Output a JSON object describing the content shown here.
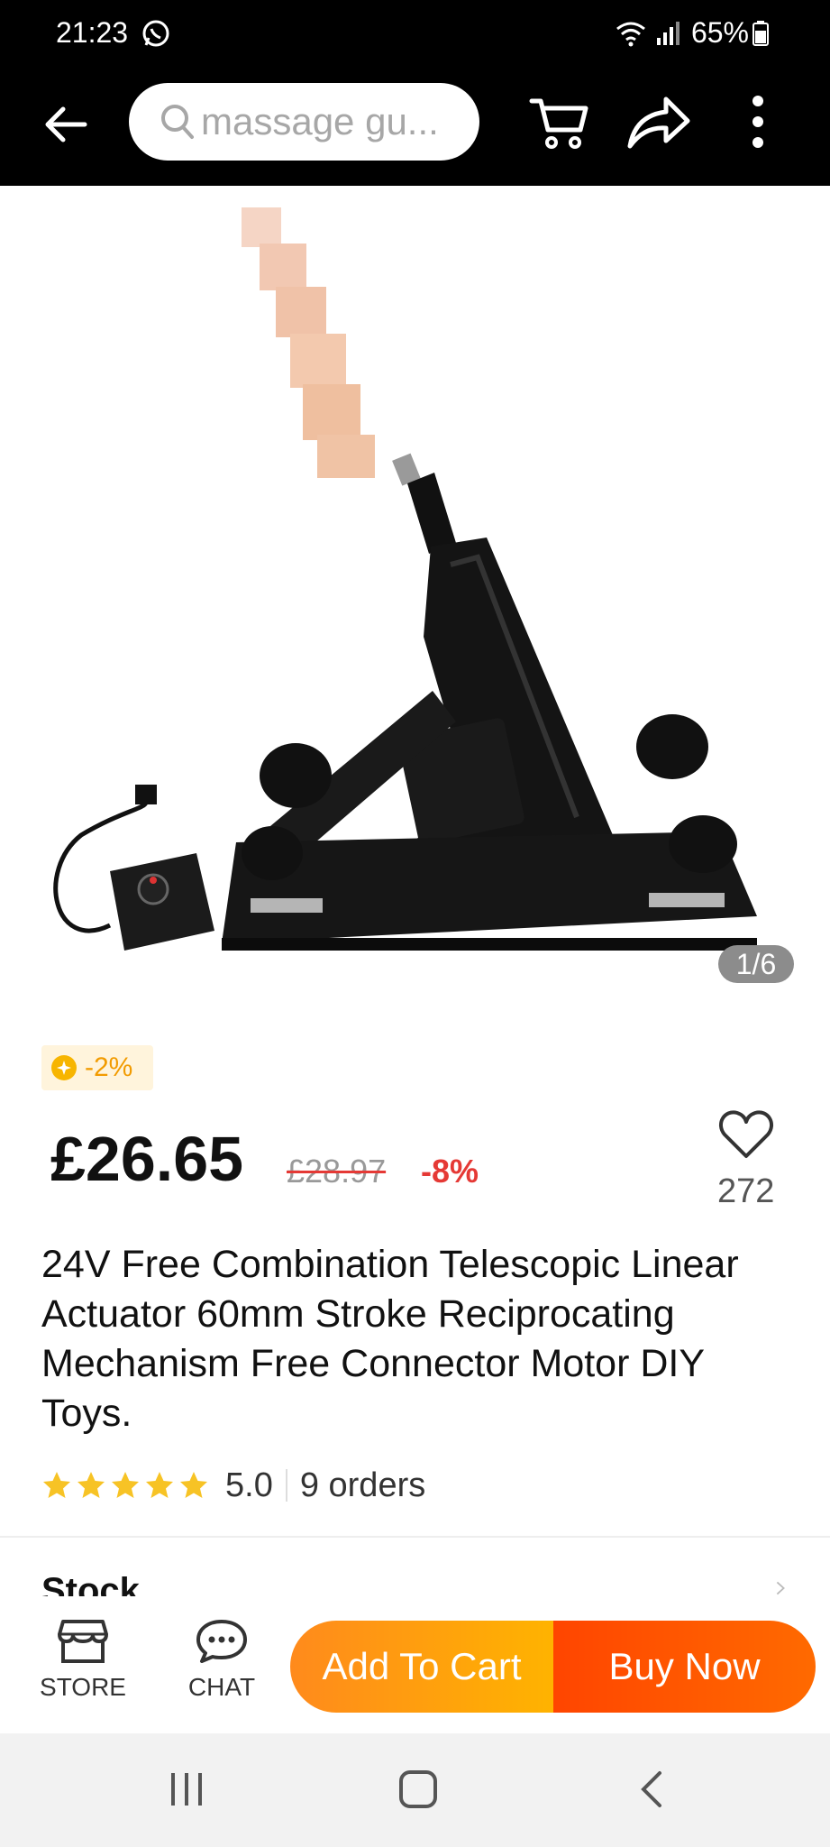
{
  "status_bar": {
    "time": "21:23",
    "battery": "65%",
    "icons": [
      "whatsapp-icon",
      "wifi-icon",
      "signal-icon",
      "battery-icon"
    ]
  },
  "top_nav": {
    "search_placeholder": "massage gu...",
    "icons": [
      "back-arrow-icon",
      "search-icon",
      "cart-icon",
      "share-icon",
      "more-vertical-icon"
    ]
  },
  "gallery": {
    "counter": "1/6"
  },
  "coin_discount": {
    "label": "-2%"
  },
  "price": {
    "current": "£26.65",
    "original": "£28.97",
    "discount": "-8%"
  },
  "wishlist": {
    "count": "272"
  },
  "product": {
    "title": "24V Free Combination Telescopic Linear Actuator 60mm Stroke Reciprocating Mechanism Free Connector Motor DIY Toys."
  },
  "rating": {
    "stars": 5,
    "value": "5.0",
    "orders": "9 orders"
  },
  "sections": {
    "stock_label": "Stock"
  },
  "action_bar": {
    "store_label": "STORE",
    "chat_label": "CHAT",
    "add_to_cart_label": "Add To Cart",
    "buy_now_label": "Buy Now"
  },
  "colors": {
    "accent_orange": "#ff8a1c",
    "buy_red_orange": "#ff4500",
    "discount_red": "#e53935",
    "star_yellow": "#f7c325"
  }
}
